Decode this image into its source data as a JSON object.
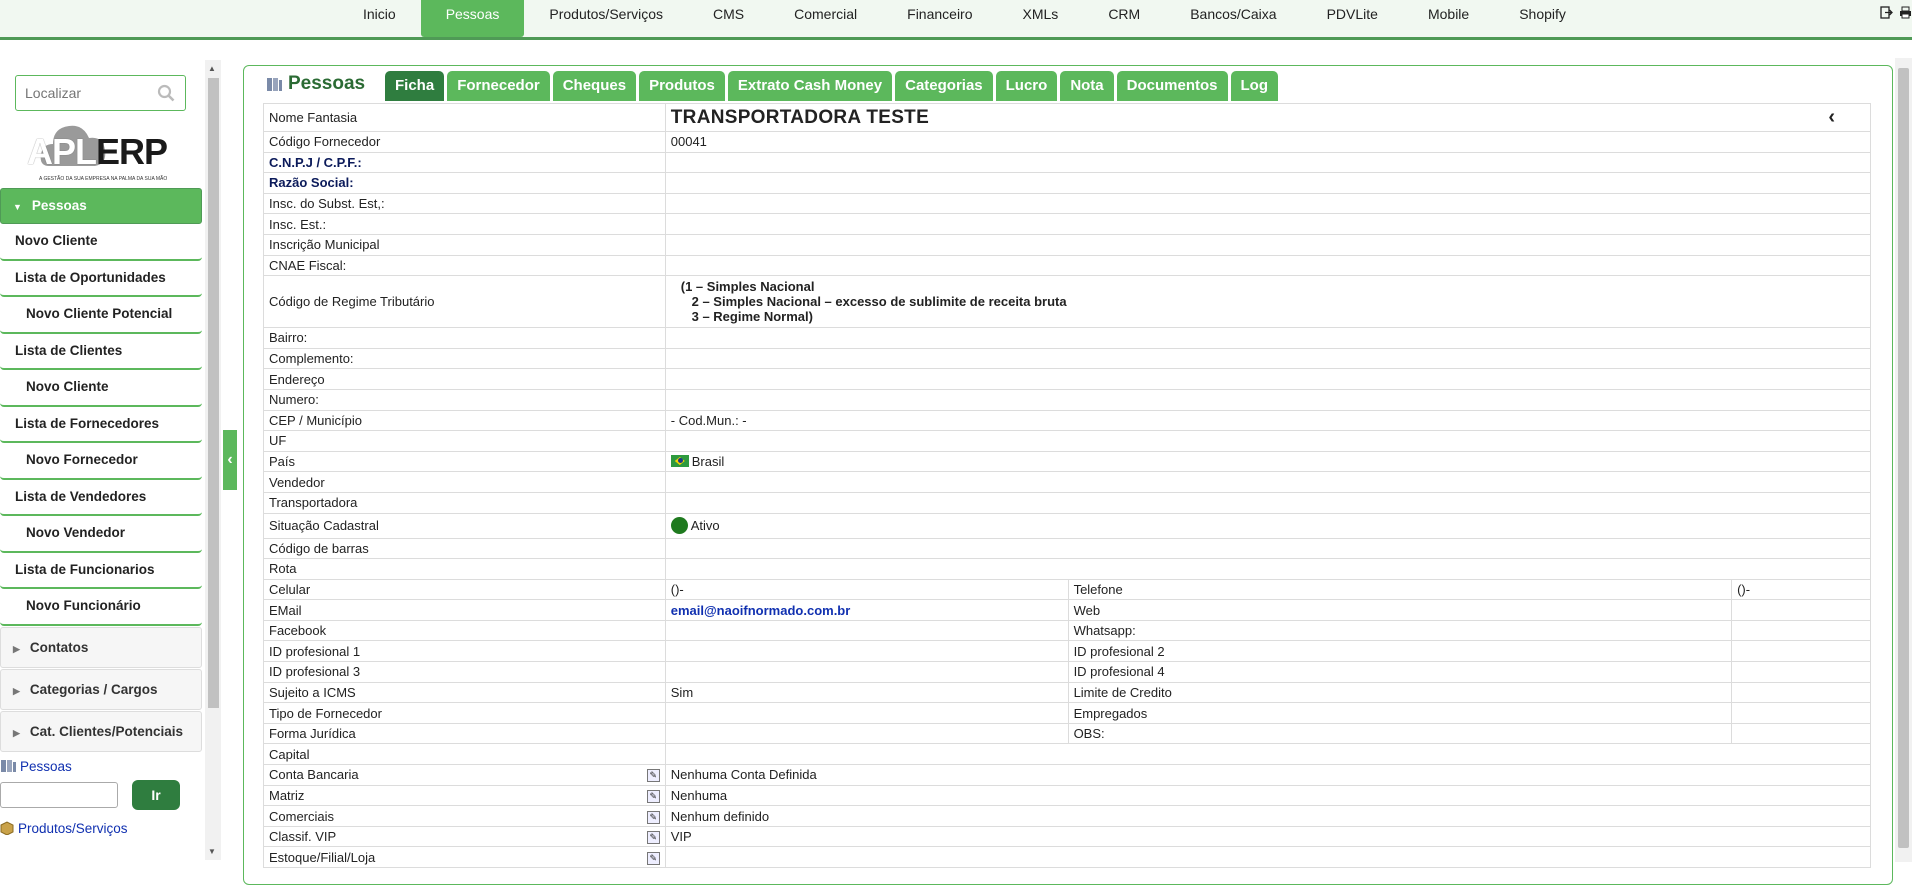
{
  "topnav": {
    "items": [
      {
        "label": "Inicio"
      },
      {
        "label": "Pessoas"
      },
      {
        "label": "Produtos/Serviços"
      },
      {
        "label": "CMS"
      },
      {
        "label": "Comercial"
      },
      {
        "label": "Financeiro"
      },
      {
        "label": "XMLs"
      },
      {
        "label": "CRM"
      },
      {
        "label": "Bancos/Caixa"
      },
      {
        "label": "PDVLite"
      },
      {
        "label": "Mobile"
      },
      {
        "label": "Shopify"
      }
    ],
    "active_index": 1,
    "icons": [
      "logout-icon",
      "print-icon"
    ]
  },
  "sidebar": {
    "search_placeholder": "Localizar",
    "logo": {
      "apl": "APL",
      "erp": "ERP",
      "tagline": "A GESTÃO DA SUA EMPRESA NA PALMA DA SUA MÃO"
    },
    "section_label": "Pessoas",
    "items": [
      {
        "label": "Novo Cliente",
        "sub": false
      },
      {
        "label": "Lista de Oportunidades",
        "sub": false
      },
      {
        "label": "Novo Cliente Potencial",
        "sub": true
      },
      {
        "label": "Lista de Clientes",
        "sub": false
      },
      {
        "label": "Novo Cliente",
        "sub": true
      },
      {
        "label": "Lista de Fornecedores",
        "sub": false
      },
      {
        "label": "Novo Fornecedor",
        "sub": true
      },
      {
        "label": "Lista de Vendedores",
        "sub": false
      },
      {
        "label": "Novo Vendedor",
        "sub": true
      },
      {
        "label": "Lista de Funcionarios",
        "sub": false
      },
      {
        "label": "Novo Funcionário",
        "sub": true
      }
    ],
    "groups": [
      {
        "label": "Contatos"
      },
      {
        "label": "Categorias / Cargos"
      },
      {
        "label": "Cat. Clientes/Potenciais"
      }
    ],
    "quick": {
      "pessoas_label": "Pessoas",
      "go_label": "Ir",
      "produtos_label": "Produtos/Serviços"
    }
  },
  "panel": {
    "title": "Pessoas",
    "tabs": [
      {
        "label": "Ficha"
      },
      {
        "label": "Fornecedor"
      },
      {
        "label": "Cheques"
      },
      {
        "label": "Produtos"
      },
      {
        "label": "Extrato Cash Money"
      },
      {
        "label": "Categorias"
      },
      {
        "label": "Lucro"
      },
      {
        "label": "Nota"
      },
      {
        "label": "Documentos"
      },
      {
        "label": "Log"
      }
    ],
    "active_tab": 0,
    "fields": {
      "nome_fantasia": {
        "label": "Nome Fantasia",
        "value": "TRANSPORTADORA TESTE"
      },
      "codigo_fornecedor": {
        "label": "Código Fornecedor",
        "value": "00041"
      },
      "cnpj": {
        "label": "C.N.P.J / C.P.F.:",
        "value": ""
      },
      "razao_social": {
        "label": "Razão Social:",
        "value": ""
      },
      "insc_subst": {
        "label": "Insc. do Subst. Est,:",
        "value": ""
      },
      "insc_est": {
        "label": "Insc. Est.:",
        "value": ""
      },
      "insc_municipal": {
        "label": "Inscrição Municipal",
        "value": ""
      },
      "cnae": {
        "label": "CNAE Fiscal:",
        "value": ""
      },
      "regime": {
        "label": "Código de Regime Tributário",
        "line1": "(1 – Simples Nacional",
        "line2": "   2 – Simples Nacional – excesso de sublimite de receita bruta",
        "line3": "   3 – Regime Normal)"
      },
      "bairro": {
        "label": "Bairro:",
        "value": ""
      },
      "complemento": {
        "label": "Complemento:",
        "value": ""
      },
      "endereco": {
        "label": "Endereço",
        "value": ""
      },
      "numero": {
        "label": "Numero:",
        "value": ""
      },
      "cep": {
        "label": "CEP / Município",
        "value": "- Cod.Mun.: -"
      },
      "uf": {
        "label": "UF",
        "value": ""
      },
      "pais": {
        "label": "País",
        "value": "Brasil"
      },
      "vendedor": {
        "label": "Vendedor",
        "value": ""
      },
      "transportadora": {
        "label": "Transportadora",
        "value": ""
      },
      "situacao": {
        "label": "Situação Cadastral",
        "value": "Ativo",
        "color": "#1f7a1f"
      },
      "codigo_barras": {
        "label": "Código de barras",
        "value": ""
      },
      "rota": {
        "label": "Rota",
        "value": ""
      },
      "celular": {
        "label": "Celular",
        "value": "()-"
      },
      "telefone": {
        "label": "Telefone",
        "value": "()-"
      },
      "email": {
        "label": "EMail",
        "value": "email@naoifnormado.com.br"
      },
      "web": {
        "label": "Web",
        "value": ""
      },
      "facebook": {
        "label": "Facebook",
        "value": ""
      },
      "whatsapp": {
        "label": "Whatsapp:",
        "value": ""
      },
      "id1": {
        "label": "ID profesional 1",
        "value": ""
      },
      "id2": {
        "label": "ID profesional 2",
        "value": ""
      },
      "id3": {
        "label": "ID profesional 3",
        "value": ""
      },
      "id4": {
        "label": "ID profesional 4",
        "value": ""
      },
      "icms": {
        "label": "Sujeito a ICMS",
        "value": "Sim"
      },
      "limite": {
        "label": "Limite de Credito",
        "value": ""
      },
      "tipo_fornecedor": {
        "label": "Tipo de Fornecedor",
        "value": ""
      },
      "empregados": {
        "label": "Empregados",
        "value": ""
      },
      "forma_juridica": {
        "label": "Forma Jurídica",
        "value": ""
      },
      "obs": {
        "label": "OBS:",
        "value": ""
      },
      "capital": {
        "label": "Capital",
        "value": ""
      },
      "conta_bancaria": {
        "label": "Conta Bancaria",
        "value": "Nenhuma Conta Definida"
      },
      "matriz": {
        "label": "Matriz",
        "value": "Nenhuma"
      },
      "comerciais": {
        "label": "Comerciais",
        "value": "Nenhum definido"
      },
      "classif_vip": {
        "label": "Classif. VIP",
        "value": "VIP"
      },
      "estoque": {
        "label": "Estoque/Filial/Loja",
        "value": ""
      }
    }
  }
}
